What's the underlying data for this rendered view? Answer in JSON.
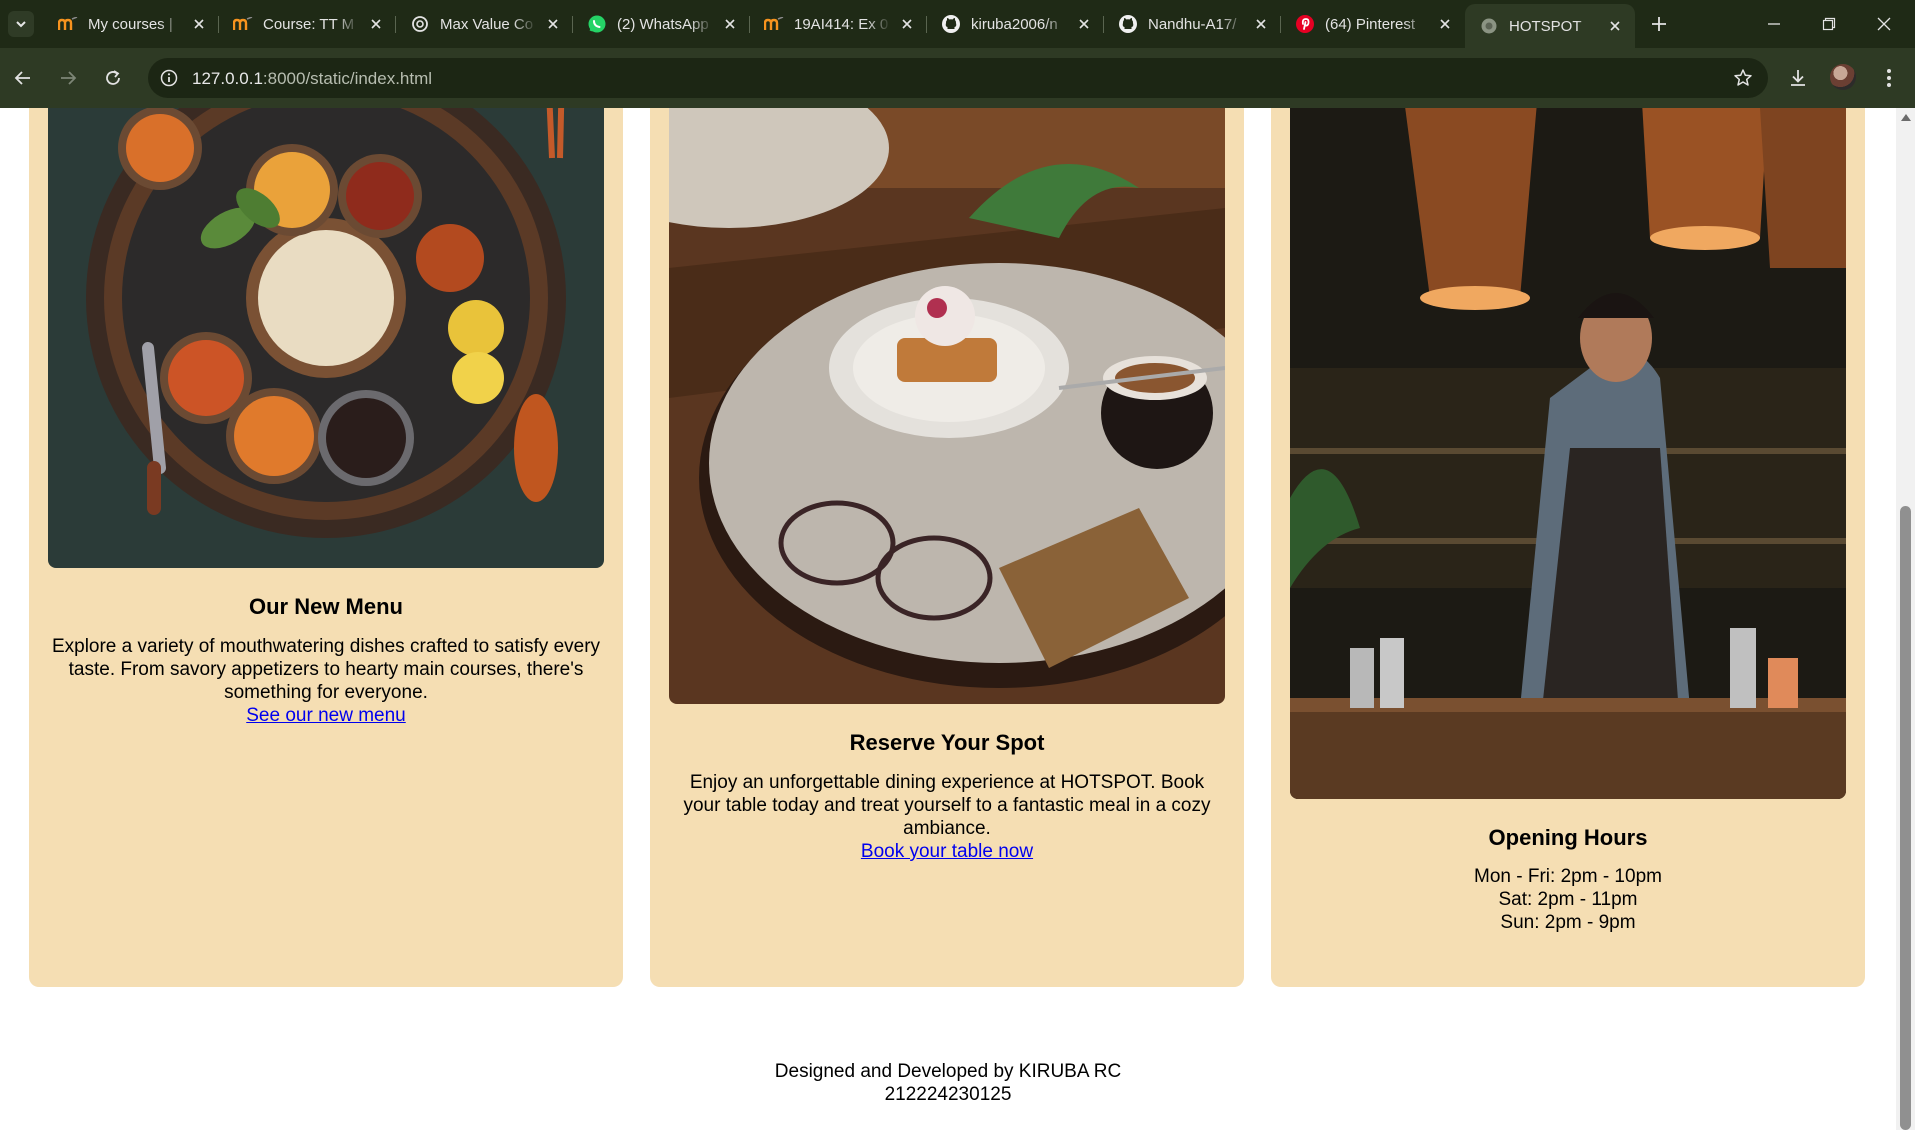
{
  "browser": {
    "tabs": [
      {
        "title": "My courses |",
        "favicon": "moodle-icon"
      },
      {
        "title": "Course: TT M",
        "favicon": "moodle-icon"
      },
      {
        "title": "Max Value Co",
        "favicon": "openai-icon"
      },
      {
        "title": "(2) WhatsApp",
        "favicon": "whatsapp-icon"
      },
      {
        "title": "19AI414: Ex 0",
        "favicon": "moodle-icon"
      },
      {
        "title": "kiruba2006/n",
        "favicon": "github-icon"
      },
      {
        "title": "Nandhu-A17/",
        "favicon": "github-icon"
      },
      {
        "title": "(64) Pinterest",
        "favicon": "pinterest-icon"
      },
      {
        "title": "HOTSPOT",
        "favicon": "globe-icon",
        "active": true
      }
    ],
    "url_host": "127.0.0.1",
    "url_rest": ":8000/static/index.html"
  },
  "cards": [
    {
      "image": "thali-illustration",
      "title": "Our New Menu",
      "text": "Explore a variety of mouthwatering dishes crafted to satisfy every taste. From savory appetizers to hearty main courses, there's something for everyone.",
      "link": "See our new menu"
    },
    {
      "image": "cafe-table-photo",
      "title": "Reserve Your Spot",
      "text": "Enjoy an unforgettable dining experience at HOTSPOT. Book your table today and treat yourself to a fantastic meal in a cozy ambiance.",
      "link": "Book your table now"
    },
    {
      "image": "bartender-photo",
      "title": "Opening Hours",
      "hours": [
        "Mon - Fri: 2pm - 10pm",
        "Sat: 2pm - 11pm",
        "Sun: 2pm - 9pm"
      ]
    }
  ],
  "footer": {
    "line1": "Designed and Developed by KIRUBA RC",
    "line2": "212224230125"
  },
  "colors": {
    "card_bg": "#f5deb3",
    "link": "#0000ee",
    "browser_frame": "#2e3a24"
  }
}
